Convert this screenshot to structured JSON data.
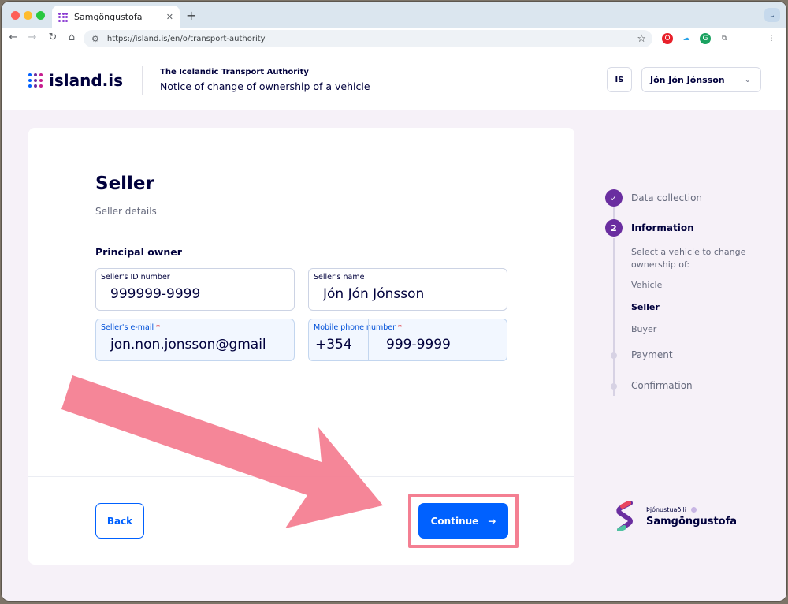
{
  "browser": {
    "tab_title": "Samgöngustofa",
    "url": "https://island.is/en/o/transport-authority",
    "close_glyph": "✕",
    "newtab_glyph": "+",
    "tab_menu_glyph": "⌄"
  },
  "header": {
    "logo_text": "island.is",
    "org_name": "The Icelandic Transport Authority",
    "form_title": "Notice of change of ownership of a vehicle",
    "lang_label": "IS",
    "user_name": "Jón Jón Jónsson"
  },
  "form": {
    "title": "Seller",
    "subtitle": "Seller details",
    "group_label": "Principal owner",
    "fields": {
      "id_label": "Seller's ID number",
      "id_value": "999999-9999",
      "name_label": "Seller's name",
      "name_value": "Jón Jón Jónsson",
      "email_label": "Seller's e-mail",
      "email_value": "jon.non.jonsson@gmail",
      "phone_label": "Mobile phone number",
      "phone_prefix": "+354",
      "phone_value": "999-9999",
      "required_mark": "*"
    },
    "back_label": "Back",
    "continue_label": "Continue"
  },
  "stepper": {
    "steps": [
      {
        "label": "Data collection",
        "state": "done"
      },
      {
        "label": "Information",
        "state": "active",
        "number": "2"
      },
      {
        "label": "Payment",
        "state": "todo"
      },
      {
        "label": "Confirmation",
        "state": "todo"
      }
    ],
    "substeps": [
      {
        "label": "Select a vehicle to change",
        "state": "todo"
      },
      {
        "label": "ownership of:",
        "state": "todo"
      },
      {
        "label": "Vehicle",
        "state": "todo"
      },
      {
        "label": "Seller",
        "state": "active"
      },
      {
        "label": "Buyer",
        "state": "todo"
      }
    ]
  },
  "provider": {
    "caption": "Þjónustuaðili",
    "name": "Samgöngustofa"
  },
  "colors": {
    "primary": "#0061ff",
    "step_purple": "#6a2ea0",
    "annotation_pink": "#f47f92",
    "page_bg": "#f6f1f8"
  }
}
